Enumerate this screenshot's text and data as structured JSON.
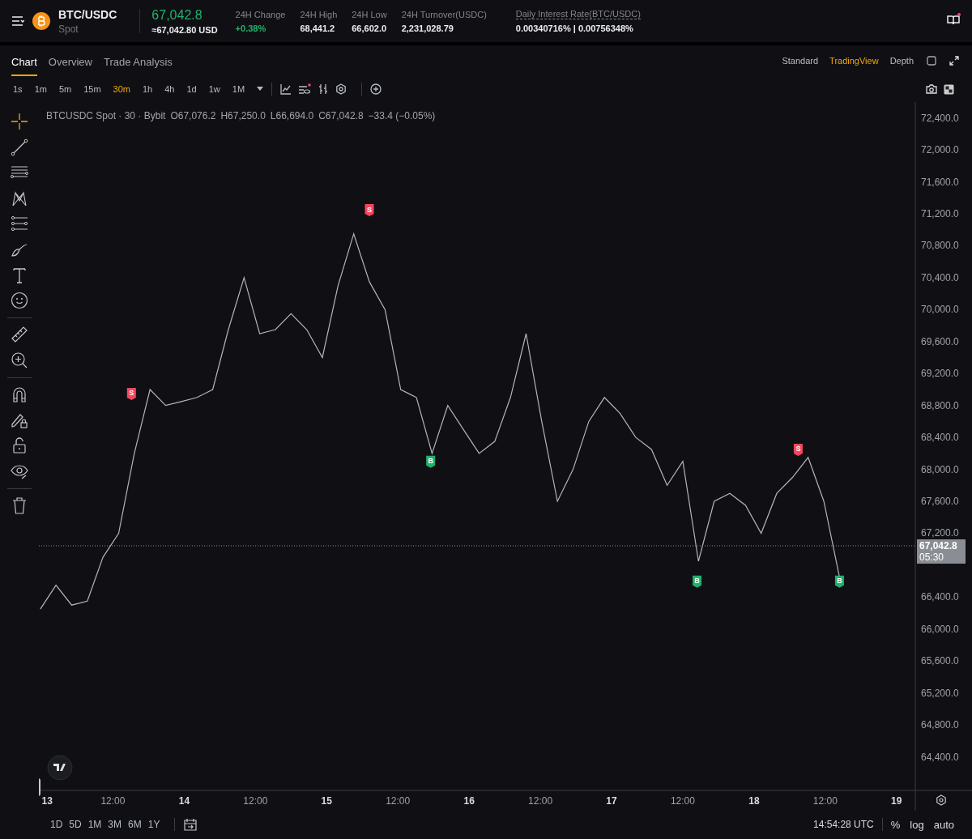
{
  "header": {
    "pair": "BTC/USDC",
    "market": "Spot",
    "price": "67,042.8",
    "price_usd": "≈67,042.80 USD",
    "stats": [
      {
        "label": "24H Change",
        "value": "+0.38%",
        "kind": "up"
      },
      {
        "label": "24H High",
        "value": "68,441.2",
        "kind": "plain"
      },
      {
        "label": "24H Low",
        "value": "66,602.0",
        "kind": "plain"
      },
      {
        "label": "24H Turnover(USDC)",
        "value": "2,231,028.79",
        "kind": "plain"
      }
    ],
    "interest": {
      "label": "Daily Interest Rate(BTC/USDC)",
      "value": "0.00340716% | 0.00756348%"
    }
  },
  "view_tabs": [
    {
      "label": "Chart",
      "selected": true
    },
    {
      "label": "Overview",
      "selected": false
    },
    {
      "label": "Trade Analysis",
      "selected": false
    }
  ],
  "chart_modes": [
    {
      "label": "Standard",
      "selected": false
    },
    {
      "label": "TradingView",
      "selected": true
    },
    {
      "label": "Depth",
      "selected": false
    }
  ],
  "intervals": [
    {
      "label": "1s",
      "selected": false
    },
    {
      "label": "1m",
      "selected": false
    },
    {
      "label": "5m",
      "selected": false
    },
    {
      "label": "15m",
      "selected": false
    },
    {
      "label": "30m",
      "selected": true
    },
    {
      "label": "1h",
      "selected": false
    },
    {
      "label": "4h",
      "selected": false
    },
    {
      "label": "1d",
      "selected": false
    },
    {
      "label": "1w",
      "selected": false
    },
    {
      "label": "1M",
      "selected": false
    }
  ],
  "legend": {
    "symbol": "BTCUSDC Spot · 30 · Bybit",
    "ohlc": [
      "O67,076.2",
      "H67,250.0",
      "L66,694.0",
      "C67,042.8"
    ],
    "change": "−33.4 (−0.05%)"
  },
  "chart": {
    "chart_data": {
      "type": "line",
      "xlim": [
        12.98,
        19.53
      ],
      "ylim": [
        63980,
        72600
      ],
      "x": [
        12.99,
        13.1,
        13.21,
        13.32,
        13.43,
        13.54,
        13.65,
        13.76,
        13.87,
        13.98,
        14.09,
        14.2,
        14.31,
        14.42,
        14.53,
        14.64,
        14.75,
        14.86,
        14.97,
        15.08,
        15.19,
        15.3,
        15.41,
        15.52,
        15.63,
        15.74,
        15.85,
        15.96,
        16.07,
        16.18,
        16.29,
        16.4,
        16.51,
        16.62,
        16.73,
        16.84,
        16.95,
        17.06,
        17.17,
        17.28,
        17.39,
        17.5,
        17.61,
        17.72,
        17.83,
        17.94,
        18.05,
        18.16,
        18.27,
        18.38,
        18.49,
        18.6
      ],
      "series": [
        {
          "color": "#b2b5be",
          "values": [
            66250,
            66550,
            66300,
            66350,
            66900,
            67200,
            68200,
            69000,
            68800,
            68850,
            68900,
            69000,
            69750,
            70400,
            69700,
            69750,
            69950,
            69750,
            69400,
            70300,
            70950,
            70350,
            70000,
            69000,
            68900,
            68200,
            68800,
            68500,
            68200,
            68350,
            68900,
            69700,
            68600,
            67600,
            68000,
            68600,
            68900,
            68700,
            68400,
            68250,
            67800,
            68100,
            66850,
            67600,
            67700,
            67550,
            67200,
            67700,
            67900,
            68150,
            67600,
            66650
          ]
        }
      ],
      "ref_lines": [
        {
          "axis": "y",
          "value": 67042.8,
          "label": "67,042.8",
          "color": "#8a8d94"
        }
      ],
      "yticks": [
        {
          "value": 72400,
          "label": "72,400.0"
        },
        {
          "value": 72000,
          "label": "72,000.0"
        },
        {
          "value": 71600,
          "label": "71,600.0"
        },
        {
          "value": 71200,
          "label": "71,200.0"
        },
        {
          "value": 70800,
          "label": "70,800.0"
        },
        {
          "value": 70400,
          "label": "70,400.0"
        },
        {
          "value": 70000,
          "label": "70,000.0"
        },
        {
          "value": 69600,
          "label": "69,600.0"
        },
        {
          "value": 69200,
          "label": "69,200.0"
        },
        {
          "value": 68800,
          "label": "68,800.0"
        },
        {
          "value": 68400,
          "label": "68,400.0"
        },
        {
          "value": 68000,
          "label": "68,000.0"
        },
        {
          "value": 67600,
          "label": "67,600.0"
        },
        {
          "value": 67200,
          "label": "67,200.0"
        },
        {
          "value": 66400,
          "label": "66,400.0"
        },
        {
          "value": 66000,
          "label": "66,000.0"
        },
        {
          "value": 65600,
          "label": "65,600.0"
        },
        {
          "value": 65200,
          "label": "65,200.0"
        },
        {
          "value": 64800,
          "label": "64,800.0"
        },
        {
          "value": 64400,
          "label": "64,400.0"
        }
      ],
      "xticks": [
        13,
        14,
        15,
        16,
        17,
        18,
        19
      ],
      "annotations": [
        {
          "text": "S",
          "x": 13.63,
          "y": 68950
        },
        {
          "text": "S",
          "x": 15.3,
          "y": 71250
        },
        {
          "text": "B",
          "x": 15.73,
          "y": 68100
        },
        {
          "text": "B",
          "x": 17.6,
          "y": 66600
        },
        {
          "text": "S",
          "x": 18.31,
          "y": 68250
        },
        {
          "text": "B",
          "x": 18.6,
          "y": 66600
        }
      ]
    },
    "midday_labels": [
      "12:00",
      "12:00",
      "12:00",
      "12:00",
      "12:00",
      "12:00"
    ],
    "trade_markers": [
      {
        "color": "#f6465d"
      },
      {
        "color": "#f6465d"
      },
      {
        "color": "#20b26c"
      },
      {
        "color": "#20b26c"
      },
      {
        "color": "#f6465d"
      },
      {
        "color": "#20b26c"
      }
    ],
    "countdown": "05:30"
  },
  "ranges": [
    "1D",
    "5D",
    "1M",
    "3M",
    "6M",
    "1Y"
  ],
  "clock": "14:54:28 UTC",
  "scale_options": [
    "%",
    "log",
    "auto"
  ]
}
